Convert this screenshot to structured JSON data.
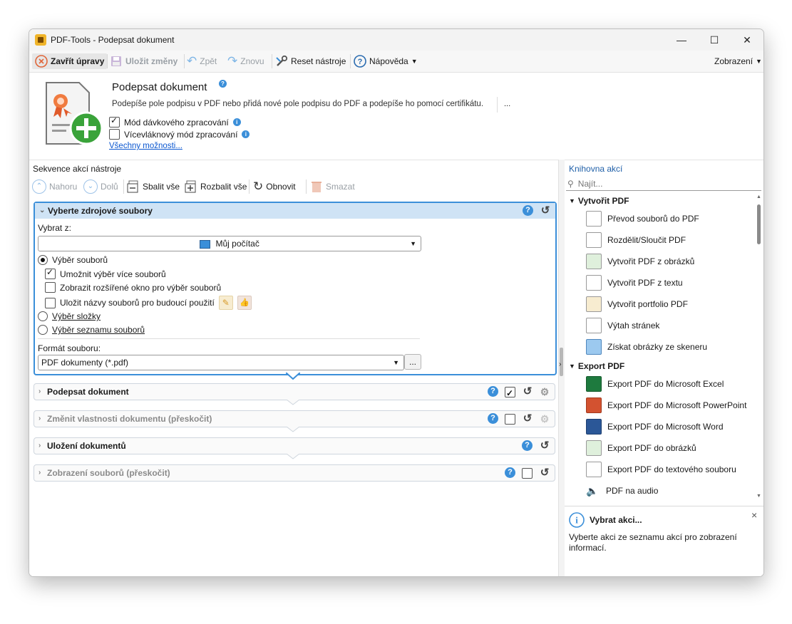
{
  "window": {
    "title": "PDF-Tools - Podepsat dokument",
    "minimize_glyph": "—",
    "maximize_glyph": "☐",
    "close_glyph": "✕"
  },
  "toolbar": {
    "close_edits": "Zavřít úpravy",
    "save_changes": "Uložit změny",
    "undo": "Zpět",
    "redo": "Znovu",
    "reset_tool": "Reset nástroje",
    "help": "Nápověda",
    "view": "Zobrazení"
  },
  "header": {
    "title": "Podepsat dokument",
    "description": "Podepíše pole podpisu v PDF nebo přidá nové pole podpisu do PDF a podepíše ho pomocí certifikátu.",
    "more": "...",
    "batch_mode": "Mód dávkového zpracování",
    "multithread_mode": "Vícevláknový mód zpracování",
    "all_options": "Všechny možnosti..."
  },
  "sequence": {
    "label": "Sekvence akcí nástroje",
    "up": "Nahoru",
    "down": "Dolů",
    "collapse_all": "Sbalit vše",
    "expand_all": "Rozbalit vše",
    "refresh": "Obnovit",
    "delete": "Smazat"
  },
  "source_panel": {
    "title": "Vyberte zdrojové soubory",
    "select_from_label": "Vybrat z:",
    "select_from_value": "Můj počítač",
    "file_selection": "Výběr souborů",
    "allow_multiple": "Umožnit výběr více souborů",
    "show_extended": "Zobrazit rozšířené okno pro výběr souborů",
    "save_names": "Uložit názvy souborů pro budoucí použití",
    "folder_selection": "Výběr složky",
    "file_list_selection": "Výběr seznamu souborů",
    "format_label": "Formát souboru:",
    "format_value": "PDF dokumenty (*.pdf)",
    "browse": "..."
  },
  "actions": [
    {
      "title": "Podepsat dokument",
      "skipped": false
    },
    {
      "title": "Změnit vlastnosti dokumentu (přeskočit)",
      "skipped": true
    },
    {
      "title": "Uložení dokumentů",
      "skipped": false
    },
    {
      "title": "Zobrazení souborů (přeskočit)",
      "skipped": true
    }
  ],
  "library": {
    "label": "Knihovna akcí",
    "search_placeholder": "Najít...",
    "groups": [
      {
        "name": "Vytvořit PDF",
        "items": [
          "Převod souborů do PDF",
          "Rozdělit/Sloučit PDF",
          "Vytvořit PDF z obrázků",
          "Vytvořit PDF z textu",
          "Vytvořit portfolio PDF",
          "Výtah stránek",
          "Získat obrázky ze skeneru"
        ]
      },
      {
        "name": "Export PDF",
        "items": [
          "Export PDF do Microsoft Excel",
          "Export PDF do Microsoft PowerPoint",
          "Export PDF do Microsoft Word",
          "Export PDF do obrázků",
          "Export PDF do textového souboru",
          "PDF na audio"
        ]
      }
    ],
    "info_title": "Vybrat akci...",
    "info_text": "Vyberte akci ze seznamu akcí pro zobrazení informací.",
    "info_close": "×"
  },
  "colors": {
    "accent": "#3b8fd9",
    "close_icon": "#e0663a",
    "add_badge": "#3aa33a"
  }
}
